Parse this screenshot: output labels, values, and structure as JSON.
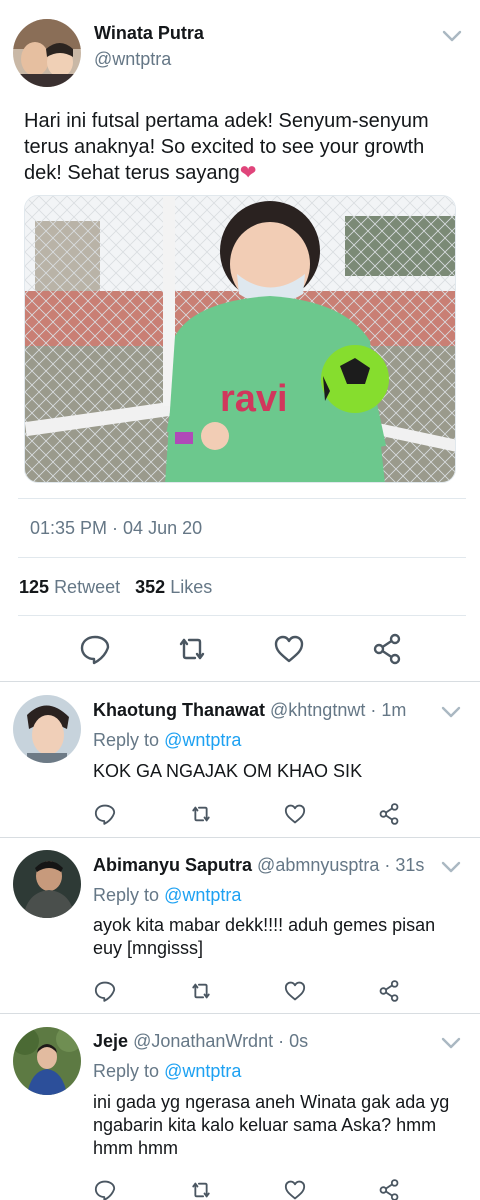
{
  "main_tweet": {
    "author_name": "Winata Putra",
    "author_handle": "@wntptra",
    "text": "Hari ini futsal pertama adek! Senyum-senyum terus anaknya! So excited to see your growth dek! Sehat terus sayang",
    "emoji": "❤",
    "photo_text": "ravi",
    "timestamp": "01:35 PM · 04 Jun 20",
    "retweet_count": "125",
    "retweet_label": "Retweet",
    "like_count": "352",
    "like_label": "Likes"
  },
  "replies": [
    {
      "name": "Khaotung Thanawat",
      "handle": "@khtngtnwt",
      "time": "· 1m",
      "reply_to_label": "Reply to",
      "reply_to_handle": "@wntptra",
      "text": "KOK GA NGAJAK OM KHAO SIK"
    },
    {
      "name": "Abimanyu Saputra",
      "handle": "@abmnyusptra",
      "time": "· 31s",
      "reply_to_label": "Reply to",
      "reply_to_handle": "@wntptra",
      "text": "ayok kita mabar dekk!!!! aduh gemes pisan euy [mngisss]"
    },
    {
      "name": "Jeje",
      "handle": "@JonathanWrdnt",
      "time": "· 0s",
      "reply_to_label": "Reply to",
      "reply_to_handle": "@wntptra",
      "text": "ini gada yg ngerasa aneh Winata gak ada yg ngabarin kita kalo keluar sama Aska? hmm hmm hmm"
    }
  ],
  "colors": {
    "accent": "#1da1f2",
    "muted": "#657786",
    "heart": "#e0457b"
  }
}
